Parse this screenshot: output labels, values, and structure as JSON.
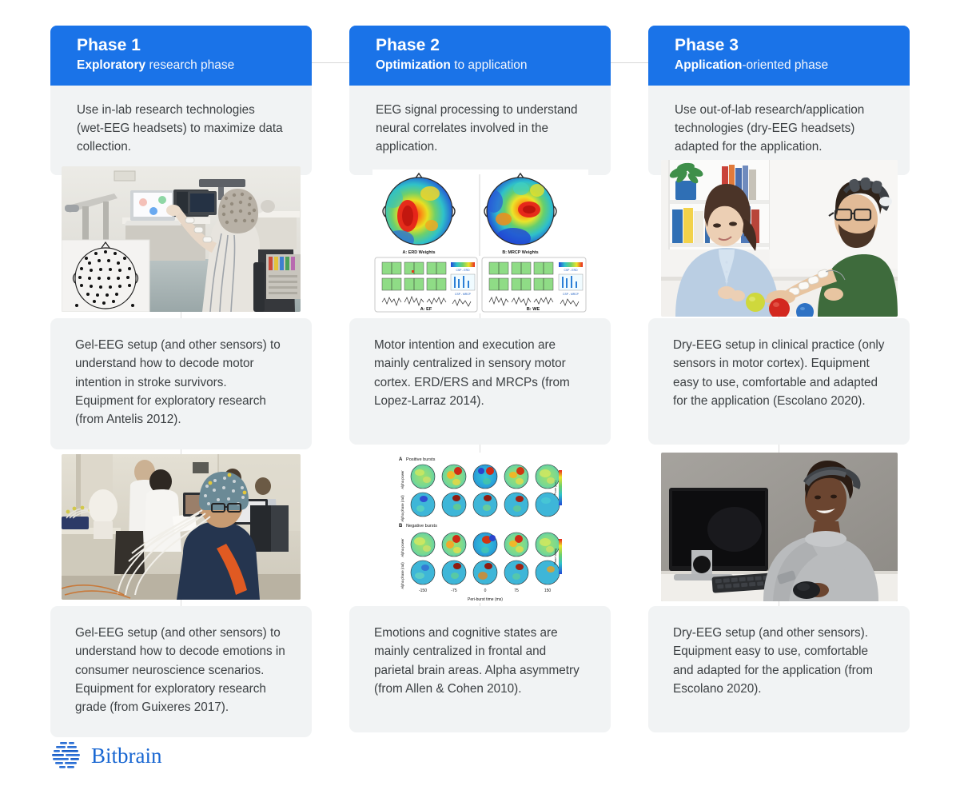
{
  "meta": {
    "accent_blue": "#1a73e8",
    "card_gray": "#f1f3f4",
    "text_gray": "#3c4043",
    "connector_gray": "#d8d8d8"
  },
  "columns": [
    {
      "id": "phase-1",
      "header": {
        "title": "Phase 1",
        "subtitle_bold": "Exploratory",
        "subtitle_rest": " research phase"
      },
      "intro": "Use in-lab research technologies (wet-EEG headsets)  to maximize data collection.",
      "media_top": {
        "name": "lab-photo-wet-eeg-stroke-rehab",
        "alt": "Stroke survivor in a wheelchair wearing a wet-EEG cap reaching toward a laptop in a research lab, with an inset 64-channel electrode montage diagram"
      },
      "body_mid": "Gel-EEG setup (and other sensors) to understand how to decode motor intention in stroke survivors. Equipment for exploratory research (from Antelis 2012).",
      "media_bottom": {
        "name": "lab-photo-wet-eeg-cap-participant",
        "alt": "Participant wearing a wet-EEG cap with many white cables seated in a busy laboratory with researchers in white coats"
      },
      "body_bottom": "Gel-EEG setup (and other sensors) to understand how to decode emotions in consumer neuroscience scenarios. Equipment for exploratory research grade (from Guixeres 2017)."
    },
    {
      "id": "phase-2",
      "header": {
        "title": "Phase 2",
        "subtitle_bold": "Optimization",
        "subtitle_rest": " to application"
      },
      "intro": "EEG signal processing to understand neural correlates involved in the application.",
      "media_top": {
        "name": "figure-erd-mrcp-weights",
        "alt": "Two EEG scalp topographic maps with jet colormap plus two grids of time-frequency panels",
        "labels": {
          "topo_a": "A: ERD Weights",
          "topo_b": "B: MRCP Weights",
          "panel_a": "A: EF",
          "panel_b": "B: WE",
          "legend_a1": "CSP - ERD",
          "legend_a2": "CSP - MRCP",
          "legend_b1": "CSP - ERD",
          "legend_b2": "CSP - MRCP"
        }
      },
      "body_mid": "Motor intention and execution are mainly centralized in sensory motor cortex. ERD/ERS and MRCPs (from Lopez-Larraz 2014).",
      "media_bottom": {
        "name": "figure-alpha-burst-topographies",
        "alt": "Grid of EEG scalp topographies for positive and negative bursts across peri-burst time",
        "labels": {
          "panel_a": "A  Positive bursts",
          "panel_b": "B  Negative bursts",
          "row_1": "Alpha power",
          "row_2": "Alpha phase (rad)",
          "row_3": "Alpha power",
          "row_4": "Alpha phase (rad)",
          "xaxis": "Peri-burst time (ms)",
          "xticks": [
            "-150",
            "-75",
            "0",
            "75",
            "150"
          ],
          "cbar_top": "Power (a.u.)",
          "cbar_bottom": "Phase locking"
        }
      },
      "body_bottom": "Emotions and cognitive states are mainly centralized in frontal and parietal brain areas. Alpha asymmetry (from Allen & Cohen 2010)."
    },
    {
      "id": "phase-3",
      "header": {
        "title": "Phase 3",
        "subtitle_bold": "Application",
        "subtitle_rest": "-oriented phase"
      },
      "intro": "Use out-of-lab research/application technologies (dry-EEG headsets) adapted for the application.",
      "media_top": {
        "name": "clinic-photo-dry-eeg-therapy-session",
        "alt": "A clinician in a light blue shirt sits at a white table opposite a bearded man in a green shirt wearing a dry-EEG headband, with electrodes on his forearm and coloured balls on the table"
      },
      "body_mid": "Dry-EEG setup in clinical practice (only sensors in motor cortex). Equipment easy to use, comfortable and adapted for the application (Escolano 2020).",
      "media_bottom": {
        "name": "office-photo-dry-eeg-headband-computer",
        "alt": "Smiling man wearing a dry-EEG headband working at a desktop computer with keyboard and mouse"
      },
      "body_bottom": "Dry-EEG setup (and other sensors). Equipment easy to use, comfortable and adapted for the application (from Escolano 2020)."
    }
  ],
  "footer": {
    "brand": "Bitbrain",
    "logo_icon": "bitbrain-dashed-circle-logo"
  }
}
